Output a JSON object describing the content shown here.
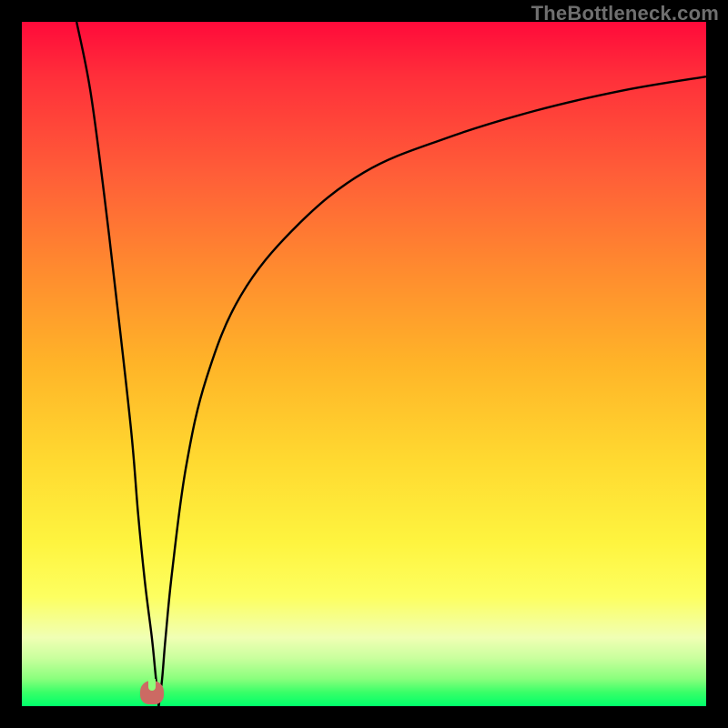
{
  "watermark": "TheBottleneck.com",
  "chart_data": {
    "type": "line",
    "title": "",
    "xlabel": "",
    "ylabel": "",
    "xlim": [
      0,
      100
    ],
    "ylim": [
      0,
      100
    ],
    "legend": false,
    "grid": false,
    "background": "red-yellow-green vertical gradient",
    "series": [
      {
        "name": "left-branch",
        "x": [
          8,
          10,
          12,
          14,
          16,
          17,
          18,
          19,
          19.5,
          19.8,
          20
        ],
        "y": [
          100,
          90,
          75,
          58,
          40,
          28,
          18,
          10,
          5,
          2,
          0
        ]
      },
      {
        "name": "right-branch",
        "x": [
          20,
          20.5,
          21,
          22,
          24,
          27,
          32,
          40,
          50,
          62,
          75,
          88,
          100
        ],
        "y": [
          0,
          4,
          10,
          20,
          35,
          48,
          60,
          70,
          78,
          83,
          87,
          90,
          92
        ]
      }
    ],
    "marker": {
      "name": "optimal-point",
      "x": 19,
      "y": 0,
      "color": "#cc6a63",
      "shape": "rounded-notch"
    }
  }
}
